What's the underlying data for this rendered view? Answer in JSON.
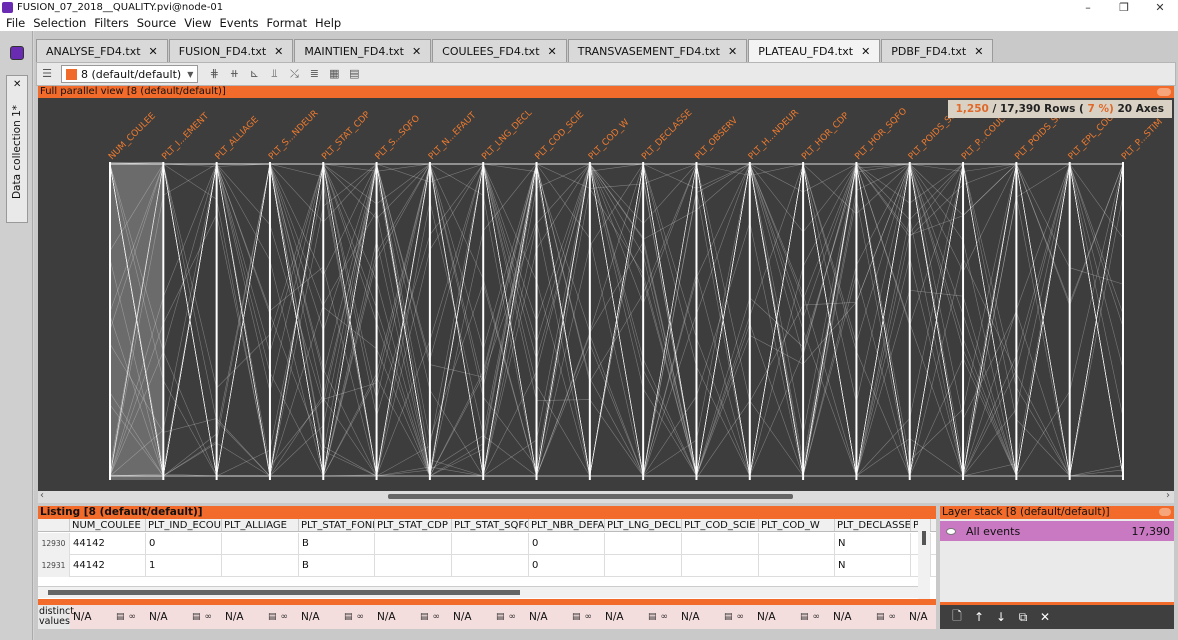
{
  "window": {
    "title": "FUSION_07_2018__QUALITY.pvi@node-01",
    "controls": [
      "–",
      "❐",
      "✕"
    ]
  },
  "menu": [
    "File",
    "Selection",
    "Filters",
    "Source",
    "View",
    "Events",
    "Format",
    "Help"
  ],
  "side": {
    "tab_label": "Data collection 1*",
    "close": "✕"
  },
  "tabs": [
    {
      "label": "ANALYSE_FD4.txt",
      "active": false
    },
    {
      "label": "FUSION_FD4.txt",
      "active": false
    },
    {
      "label": "MAINTIEN_FD4.txt",
      "active": false
    },
    {
      "label": "COULEES_FD4.txt",
      "active": false
    },
    {
      "label": "TRANSVASEMENT_FD4.txt",
      "active": false
    },
    {
      "label": "PLATEAU_FD4.txt",
      "active": true
    },
    {
      "label": "PDBF_FD4.txt",
      "active": false
    }
  ],
  "tab_close": "✕",
  "toolbar": {
    "layer_label": "8 (default/default)",
    "accent": "#f06a2a"
  },
  "parallel_view": {
    "header": "Full parallel view [8 (default/default)]",
    "rows_selected": "1,250",
    "rows_total": "/ 17,390 Rows (",
    "rows_pct": "7 %)",
    "axes_count": "20 Axes",
    "axes": [
      "NUM_COULEE",
      "PLT_I...EMENT",
      "PLT_ALLIAGE",
      "PLT_S...NDEUR",
      "PLT_STAT_CDP",
      "PLT_S...SQFO",
      "PLT_N...EFAUT",
      "PLT_LNG_DECL",
      "PLT_COD_SCIE",
      "PLT_COD_W",
      "PLT_DECLASSE",
      "PLT_OBSERV",
      "PLT_H...NDEUR",
      "PLT_HOR_CDP",
      "PLT_HOR_SQFO",
      "PLT_POIDS_S...",
      "PLT_P...COUL",
      "PLT_POIDS_S...",
      "PLT_EPL_COUL",
      "PLT_P...STIM"
    ]
  },
  "listing": {
    "header": "Listing [8 (default/default)]",
    "columns": [
      "",
      "NUM_COULEE",
      "PLT_IND_ECOUL",
      "PLT_ALLIAGE",
      "PLT_STAT_FOND",
      "PLT_STAT_CDP",
      "PLT_STAT_SQFO",
      "PLT_NBR_DEFAL",
      "PLT_LNG_DECL",
      "PLT_COD_SCIE",
      "PLT_COD_W",
      "PLT_DECLASSE",
      "P"
    ],
    "rows": [
      [
        "12930",
        "44142",
        "0",
        "",
        "B",
        "",
        "",
        "0",
        "",
        "",
        "",
        "N",
        ""
      ],
      [
        "12931",
        "44142",
        "1",
        "",
        "B",
        "",
        "",
        "0",
        "",
        "",
        "",
        "N",
        ""
      ]
    ],
    "distinct_label": "distinct values",
    "distinct_values": [
      "N/A",
      "N/A",
      "N/A",
      "N/A",
      "N/A",
      "N/A",
      "N/A",
      "N/A",
      "N/A",
      "N/A",
      "N/A",
      "N/A"
    ]
  },
  "layer_stack": {
    "header": "Layer stack [8 (default/default)]",
    "layers": [
      {
        "name": "All events",
        "count": "17,390",
        "color": "#c879c2"
      }
    ],
    "tools": [
      "🗋",
      "↑",
      "↓",
      "⧉",
      "✕"
    ]
  }
}
